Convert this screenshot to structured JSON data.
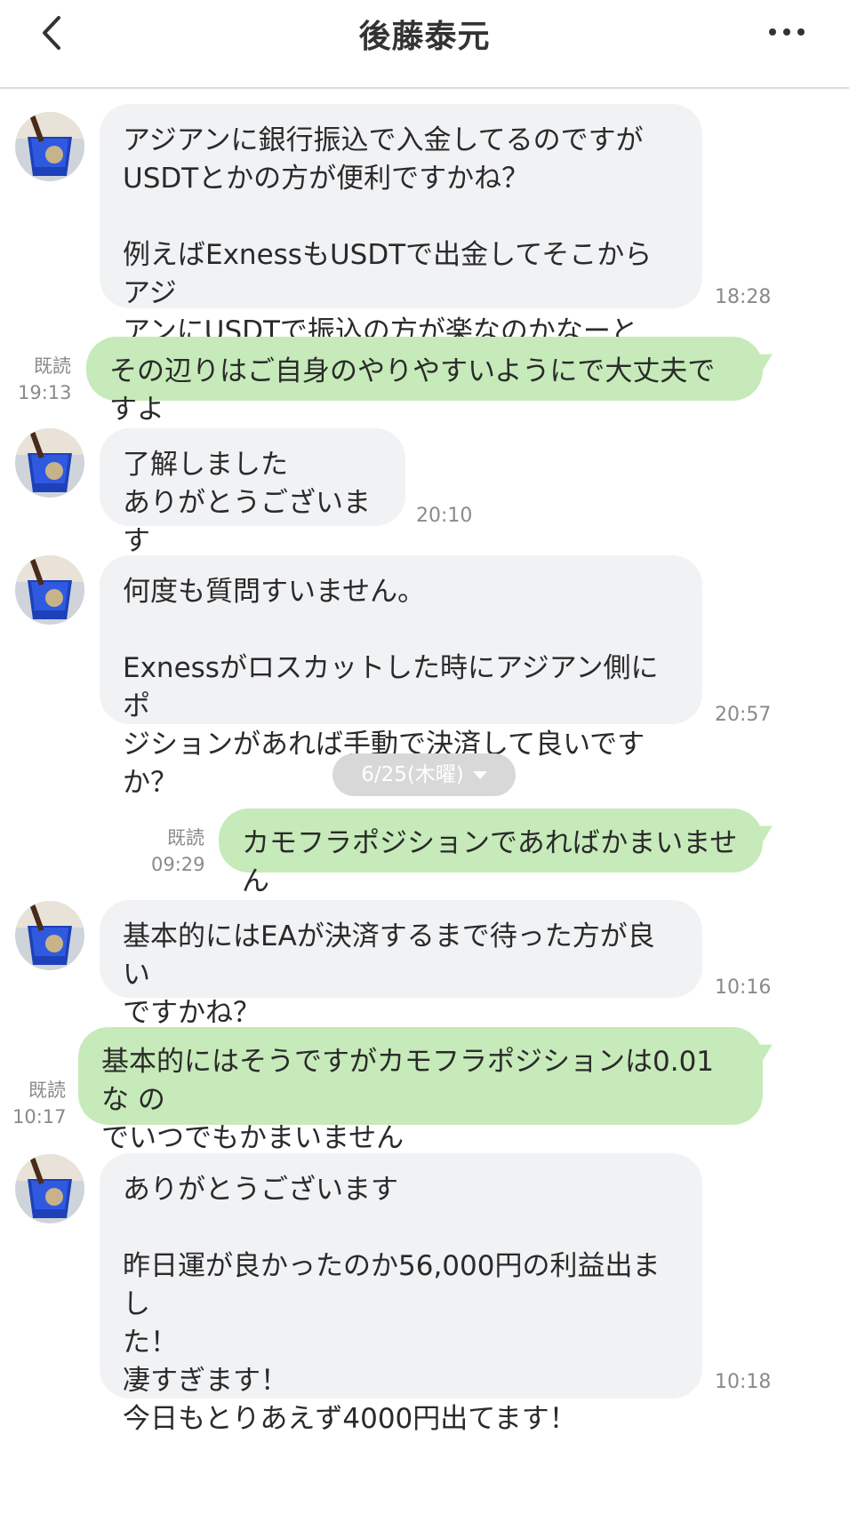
{
  "header": {
    "title": "後藤泰元"
  },
  "icons": {
    "back": "chevron-left-icon",
    "more": "more-horizontal-icon",
    "date_dropdown": "caret-down-icon"
  },
  "colors": {
    "incoming_bubble": "#f1f2f4",
    "outgoing_bubble": "#c6eab9",
    "meta_text": "#8a8a8a"
  },
  "date_separator": "6/25(木曜)",
  "messages": [
    {
      "direction": "in",
      "text": "アジアンに銀行振込で入金してるのですが\nUSDTとかの方が便利ですかね？\n\n例えばExnessもUSDTで出金してそこからアジ\nアンにUSDTで振込の方が楽なのかなーと",
      "time": "18:28"
    },
    {
      "direction": "out",
      "text": "その辺りはご自身のやりやすいようにで大丈夫ですよ",
      "read": "既読",
      "time": "19:13"
    },
    {
      "direction": "in",
      "text": "了解しました\nありがとうございます",
      "time": "20:10"
    },
    {
      "direction": "in",
      "text": "何度も質問すいません。\n\nExnessがロスカットした時にアジアン側にポ\nジションがあれば手動で決済して良いですか？",
      "time": "20:57"
    },
    {
      "direction": "out",
      "text": "カモフラポジションであればかまいません",
      "read": "既読",
      "time": "09:29"
    },
    {
      "direction": "in",
      "text": "基本的にはEAが決済するまで待った方が良い\nですかね？",
      "time": "10:16"
    },
    {
      "direction": "out",
      "text": "基本的にはそうですがカモフラポジションは0.01な の\nでいつでもかまいません",
      "read": "既読",
      "time": "10:17"
    },
    {
      "direction": "in",
      "text": "ありがとうございます\n\n昨日運が良かったのか56,000円の利益出まし\nた！\n凄すぎます！\n今日もとりあえず4000円出てます！",
      "time": "10:18"
    }
  ]
}
